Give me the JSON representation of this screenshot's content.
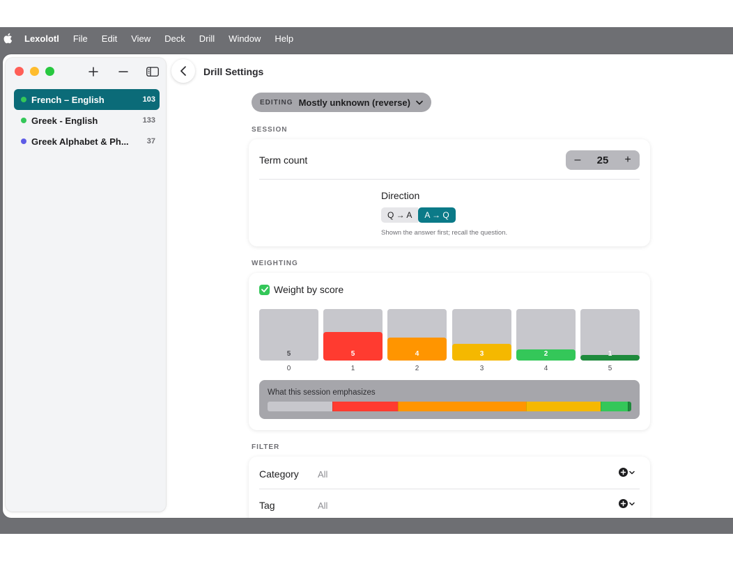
{
  "menubar": {
    "app": "Lexolotl",
    "items": [
      "File",
      "Edit",
      "View",
      "Deck",
      "Drill",
      "Window",
      "Help"
    ]
  },
  "sidebar": {
    "decks": [
      {
        "name": "French – English",
        "count": "103",
        "color": "#34c759",
        "selected": true
      },
      {
        "name": "Greek - English",
        "count": "133",
        "color": "#34c759",
        "selected": false
      },
      {
        "name": "Greek Alphabet & Ph...",
        "count": "37",
        "color": "#5e5ce6",
        "selected": false
      }
    ]
  },
  "header": {
    "title": "Drill Settings"
  },
  "preset": {
    "label": "EDITING",
    "value": "Mostly unknown (reverse)"
  },
  "session": {
    "section": "SESSION",
    "term_label": "Term count",
    "term_value": "25",
    "minus": "–",
    "plus": "+",
    "direction_label": "Direction",
    "direction_options": [
      "Q → A",
      "A → Q"
    ],
    "direction_selected": 1,
    "direction_hint": "Shown the answer first; recall the question."
  },
  "weighting": {
    "section": "WEIGHTING",
    "checkbox_label": "Weight by score",
    "checked": true,
    "scores": [
      {
        "score": "0",
        "weight": 5,
        "level": 0.0,
        "color": "#c7c7cc"
      },
      {
        "score": "1",
        "weight": 5,
        "level": 0.55,
        "color": "#ff3b30"
      },
      {
        "score": "2",
        "weight": 4,
        "level": 0.44,
        "color": "#ff9500"
      },
      {
        "score": "3",
        "weight": 3,
        "level": 0.33,
        "color": "#f5b800"
      },
      {
        "score": "4",
        "weight": 2,
        "level": 0.22,
        "color": "#34c759"
      },
      {
        "score": "5",
        "weight": 1,
        "level": 0.11,
        "color": "#1e8a3c"
      }
    ],
    "emphasis_title": "What this session emphasizes",
    "emphasis": [
      {
        "color": "#c7c7cc",
        "share": 0.18
      },
      {
        "color": "#ff3b30",
        "share": 0.18
      },
      {
        "color": "#ff9500",
        "share": 0.355
      },
      {
        "color": "#f5b800",
        "share": 0.205
      },
      {
        "color": "#34c759",
        "share": 0.075
      },
      {
        "color": "#1e8a3c",
        "share": 0.01
      }
    ]
  },
  "filter": {
    "section": "FILTER",
    "rows": [
      {
        "label": "Category",
        "value": "All"
      },
      {
        "label": "Tag",
        "value": "All"
      }
    ]
  }
}
